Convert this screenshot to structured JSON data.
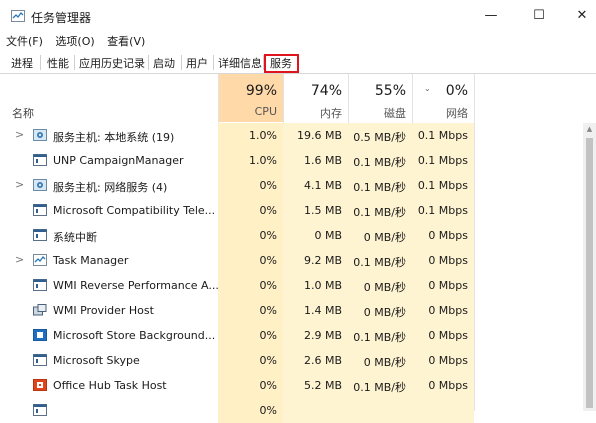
{
  "window": {
    "title": "任务管理器",
    "controls": {
      "minimize": "—",
      "maximize": "☐",
      "close": "✕"
    }
  },
  "menu": [
    "文件(F)",
    "选项(O)",
    "查看(V)"
  ],
  "tabs": [
    {
      "label": "进程",
      "selected": true
    },
    {
      "label": "性能"
    },
    {
      "label": "应用历史记录"
    },
    {
      "label": "启动"
    },
    {
      "label": "用户"
    },
    {
      "label": "详细信息"
    },
    {
      "label": "服务",
      "highlighted": true
    }
  ],
  "columns": {
    "name": {
      "label": "名称"
    },
    "cpu": {
      "pct": "99%",
      "label": "CPU"
    },
    "memory": {
      "pct": "74%",
      "label": "内存"
    },
    "disk": {
      "pct": "55%",
      "label": "磁盘"
    },
    "network": {
      "pct": "0%",
      "label": "网络"
    }
  },
  "rows": [
    {
      "expand": true,
      "icon": "gear-icon",
      "name": "服务主机: 本地系统 (19)",
      "cpu": "1.0%",
      "mem": "19.6 MB",
      "disk": "0.5 MB/秒",
      "net": "0.1 Mbps"
    },
    {
      "expand": false,
      "icon": "window-icon",
      "name": "UNP CampaignManager",
      "cpu": "1.0%",
      "mem": "1.6 MB",
      "disk": "0.1 MB/秒",
      "net": "0.1 Mbps"
    },
    {
      "expand": true,
      "icon": "gear-icon",
      "name": "服务主机: 网络服务 (4)",
      "cpu": "0%",
      "mem": "4.1 MB",
      "disk": "0.1 MB/秒",
      "net": "0.1 Mbps"
    },
    {
      "expand": false,
      "icon": "window-icon",
      "name": "Microsoft Compatibility Tele...",
      "cpu": "0%",
      "mem": "1.5 MB",
      "disk": "0.1 MB/秒",
      "net": "0.1 Mbps"
    },
    {
      "expand": false,
      "icon": "window-icon",
      "name": "系统中断",
      "cpu": "0%",
      "mem": "0 MB",
      "disk": "0 MB/秒",
      "net": "0 Mbps"
    },
    {
      "expand": true,
      "icon": "task-manager-icon",
      "name": "Task Manager",
      "cpu": "0%",
      "mem": "9.2 MB",
      "disk": "0.1 MB/秒",
      "net": "0 Mbps"
    },
    {
      "expand": false,
      "icon": "window-icon",
      "name": "WMI Reverse Performance A...",
      "cpu": "0%",
      "mem": "1.0 MB",
      "disk": "0 MB/秒",
      "net": "0 Mbps"
    },
    {
      "expand": false,
      "icon": "wmi-icon",
      "name": "WMI Provider Host",
      "cpu": "0%",
      "mem": "1.4 MB",
      "disk": "0 MB/秒",
      "net": "0 Mbps"
    },
    {
      "expand": false,
      "icon": "store-icon",
      "name": "Microsoft Store Background...",
      "cpu": "0%",
      "mem": "2.9 MB",
      "disk": "0.1 MB/秒",
      "net": "0 Mbps"
    },
    {
      "expand": false,
      "icon": "window-icon",
      "name": "Microsoft Skype",
      "cpu": "0%",
      "mem": "2.6 MB",
      "disk": "0 MB/秒",
      "net": "0 Mbps"
    },
    {
      "expand": false,
      "icon": "office-icon",
      "name": "Office Hub Task Host",
      "cpu": "0%",
      "mem": "5.2 MB",
      "disk": "0.1 MB/秒",
      "net": "0 Mbps"
    },
    {
      "expand": false,
      "icon": "window-icon",
      "name": "",
      "cpu": "0%",
      "mem": "",
      "disk": "",
      "net": ""
    }
  ],
  "colors": {
    "cpu_header": "#ffd9a8",
    "cpu_cells": "#fff0c6",
    "other_cells": "#fff4d2",
    "tab_highlight": "#e0141e"
  }
}
